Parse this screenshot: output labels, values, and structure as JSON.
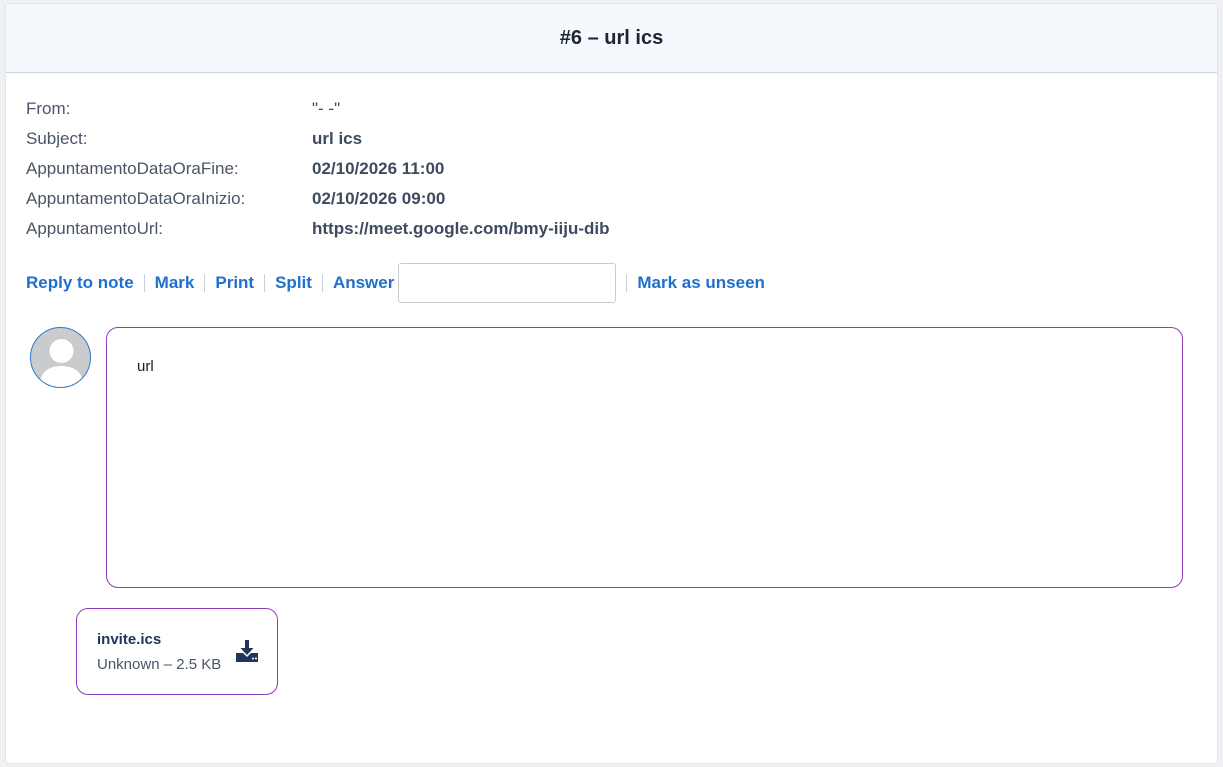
{
  "header": {
    "title": "#6 – url ics"
  },
  "meta": [
    {
      "key": "From:",
      "value": "\"- -\""
    },
    {
      "key": "Subject:",
      "value": "url ics"
    },
    {
      "key": "AppuntamentoDataOraFine:",
      "value": "02/10/2026 11:00"
    },
    {
      "key": "AppuntamentoDataOraInizio:",
      "value": "02/10/2026 09:00"
    },
    {
      "key": "AppuntamentoUrl:",
      "value": "https://meet.google.com/bmy-iiju-dib"
    }
  ],
  "actions": {
    "reply_to_note": "Reply to note",
    "mark": "Mark",
    "print": "Print",
    "split": "Split",
    "answer": "Answer",
    "answer_value": "",
    "mark_unseen": "Mark as unseen"
  },
  "message": {
    "body": "url"
  },
  "attachment": {
    "name": "invite.ics",
    "info": "Unknown – 2.5 KB",
    "download_icon": "download-icon"
  },
  "colors": {
    "accent": "#1f6fcf",
    "border_purple": "#8f3cb8",
    "icon_navy": "#20345c"
  }
}
